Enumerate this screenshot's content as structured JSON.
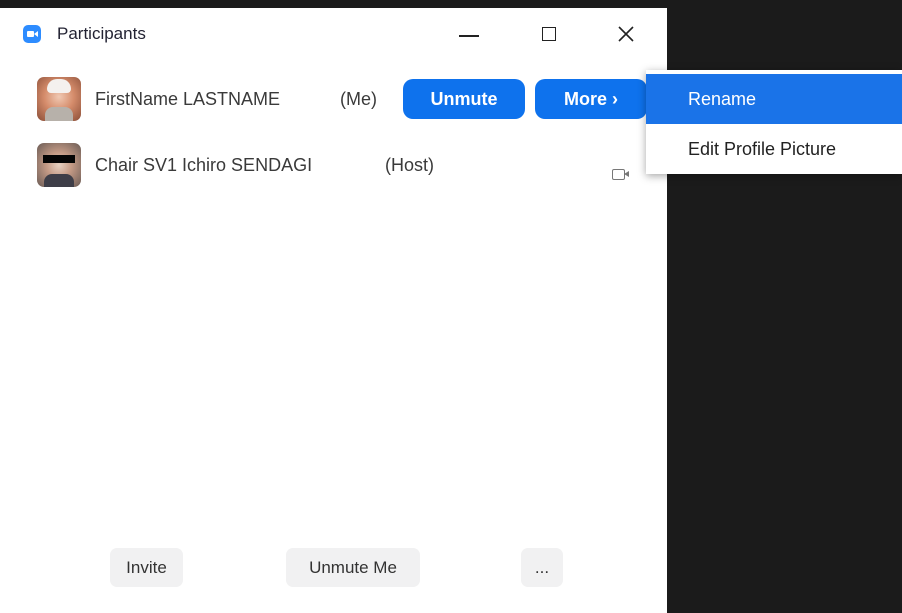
{
  "window": {
    "title": "Participants"
  },
  "participants": [
    {
      "name": "FirstName LASTNAME",
      "tag": "(Me)",
      "unmute_label": "Unmute",
      "more_label": "More",
      "more_chevron": "›"
    },
    {
      "name": "Chair SV1 Ichiro SENDAGI",
      "tag": "(Host)"
    }
  ],
  "context_menu": {
    "items": [
      {
        "label": "Rename"
      },
      {
        "label": "Edit Profile Picture"
      }
    ]
  },
  "footer": {
    "invite_label": "Invite",
    "unmute_me_label": "Unmute Me",
    "more_label": "..."
  },
  "colors": {
    "accent": "#0e72ed",
    "menu_highlight": "#1a73e8",
    "dark_background": "#1b1b1b"
  },
  "icons": {
    "app": "zoom-app-icon",
    "minimize": "minimize-icon",
    "maximize": "maximize-icon",
    "close": "close-icon",
    "video": "video-camera-icon"
  }
}
